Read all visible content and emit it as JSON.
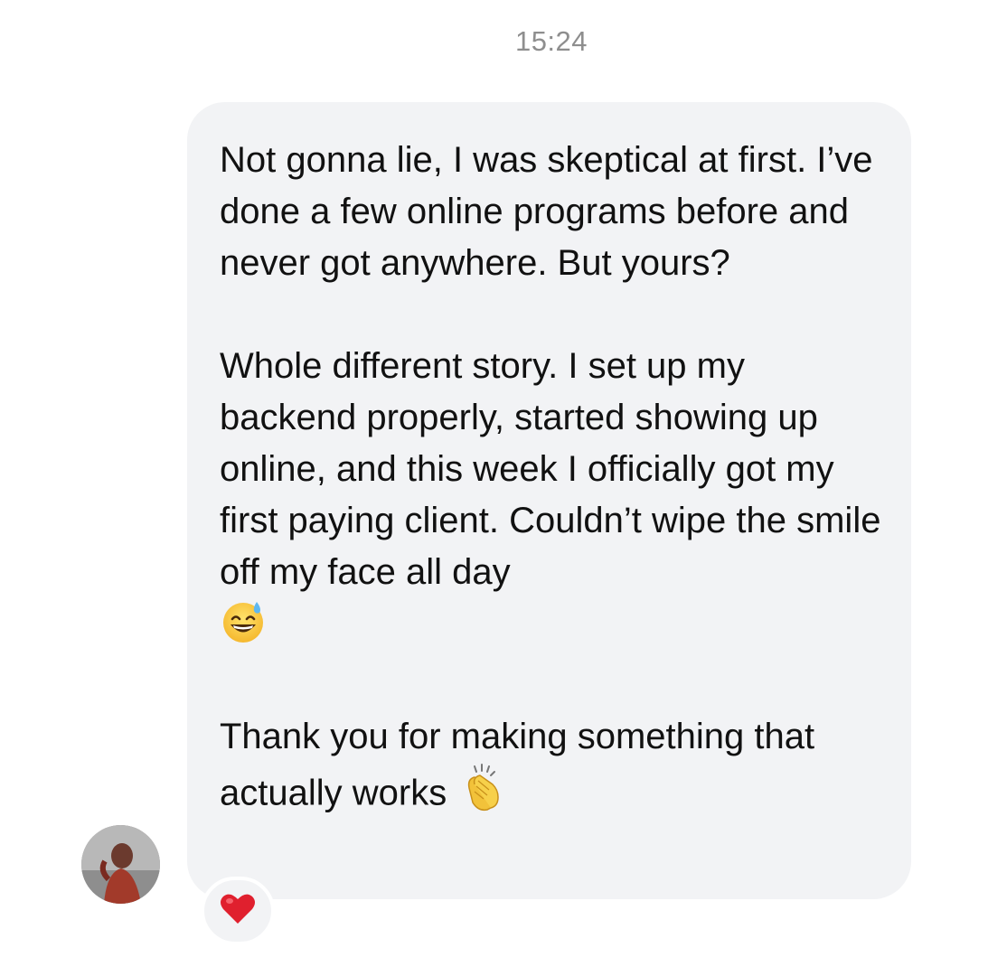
{
  "timestamp": "15:24",
  "message": {
    "paragraphs": [
      "Not gonna lie, I was skeptical at first. I’ve done a few online programs before and never got anywhere. But yours?",
      "Whole different story. I set up my backend properly, started showing up online, and this week I officially got my first paying client. Couldn’t wipe the smile off my face all day",
      "Thank you for making something that actually works"
    ]
  },
  "icons": {
    "para2_end": "grinning-sweat-emoji-icon",
    "para3_end": "clapping-hands-emoji-icon",
    "reaction": "red-heart-icon",
    "avatar": "sender-avatar"
  },
  "colors": {
    "bubble": "#f2f3f5",
    "text": "#111111",
    "timestamp": "#8e8e8e",
    "heart": "#e0202e"
  }
}
